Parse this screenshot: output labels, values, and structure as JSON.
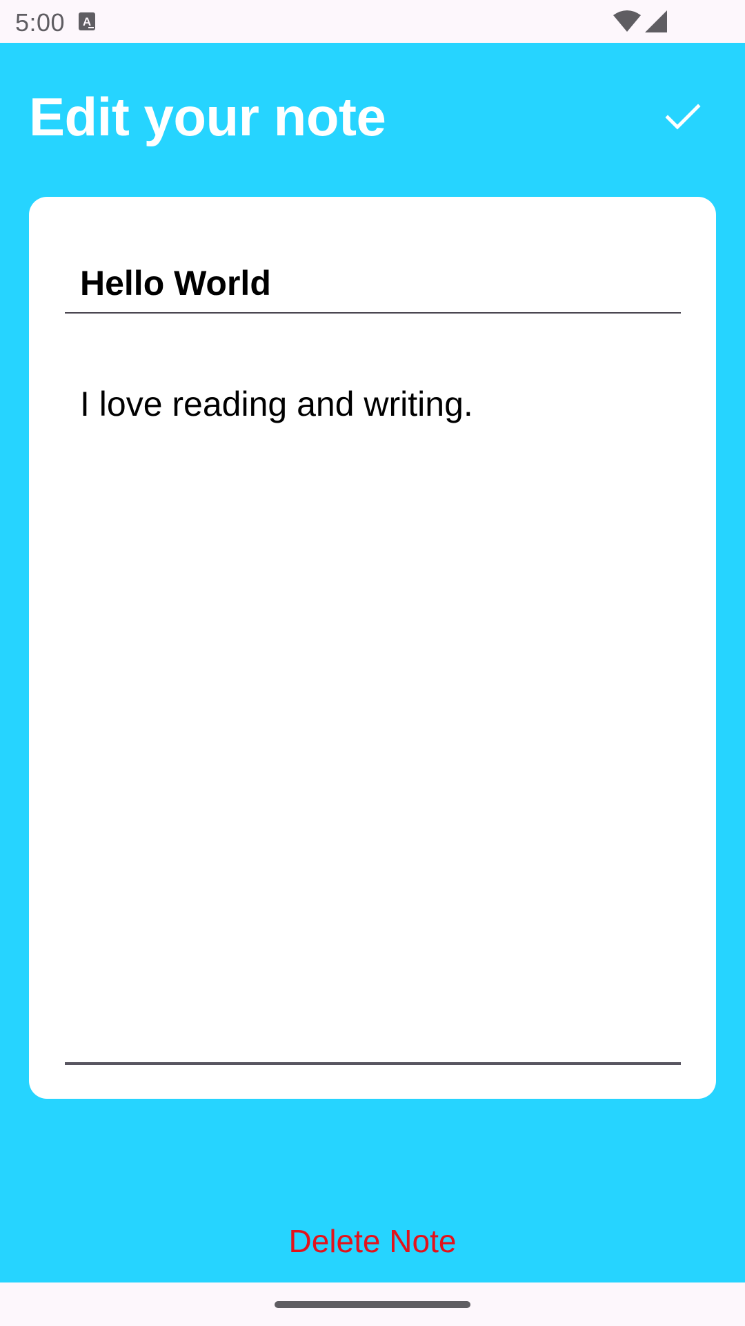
{
  "status_bar": {
    "time": "5:00",
    "icons": [
      "text-notification-icon",
      "wifi-icon",
      "cell-signal-icon"
    ]
  },
  "header": {
    "title": "Edit your note",
    "save_icon": "check-icon"
  },
  "note": {
    "title_value": "Hello World",
    "body_value": "I love reading and writing."
  },
  "actions": {
    "delete_label": "Delete Note"
  },
  "colors": {
    "background": "#26d4ff",
    "card": "#ffffff",
    "delete": "#e3121b",
    "title_text": "#ffffff"
  }
}
